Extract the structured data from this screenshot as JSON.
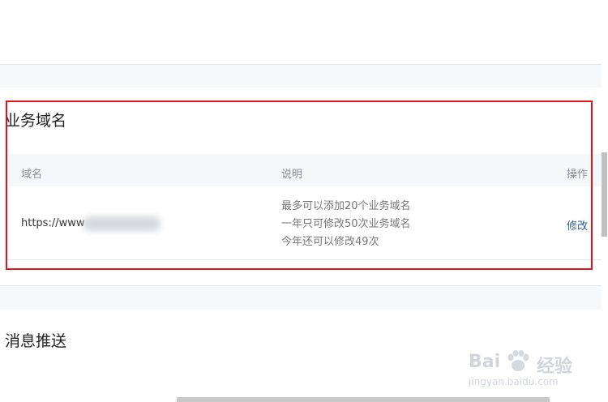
{
  "sections": {
    "business_domain": {
      "title": "业务域名"
    },
    "message_push": {
      "title": "消息推送"
    }
  },
  "table": {
    "headers": {
      "domain": "域名",
      "description": "说明",
      "action": "操作"
    },
    "rows": [
      {
        "domain": "https://www",
        "description_lines": [
          "最多可以添加20个业务域名",
          "一年只可修改50次业务域名",
          "今年还可以修改49次"
        ],
        "action": "修改"
      }
    ]
  },
  "watermark": {
    "brand": "Bai",
    "brand_suffix": "经验",
    "url": "jingyan.baidu.com"
  },
  "colors": {
    "highlight": "#e0151b",
    "link": "#2b5d95",
    "strip": "#f7f8fa"
  }
}
